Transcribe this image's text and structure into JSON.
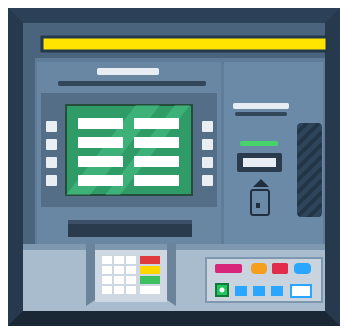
{
  "device": {
    "name": "atm-machine",
    "colors": {
      "frame_dark": "#1f2f3f",
      "bevel": "#2c4157",
      "body": "#4b647d",
      "panel": "#6b8fb0",
      "screen_bezel": "#546e87",
      "screen_bg": "#2f9c67",
      "screen_stripe": "#3bb879",
      "screen_button": "#ffffff",
      "side_button": "#e9eef3",
      "header_light": "#ffe400",
      "card_indicator": "#46d36a",
      "receipt_slot": "#2a3b4d",
      "keypad_bg": "#cfd8e2",
      "key": "#ffffff",
      "key_red": "#e03a3e",
      "key_yellow": "#ffd600",
      "key_green": "#3bbf5f",
      "control_panel": "#c9d4df",
      "btn_magenta": "#d8267a",
      "btn_orange": "#f59f1f",
      "btn_red": "#e32b4b",
      "btn_blue": "#2aa6ff",
      "btn_green": "#22c55e",
      "btn_white": "#ffffff"
    },
    "screen": {
      "rows": 4,
      "columns": 2
    },
    "side_buttons_per_side": 4,
    "keypad": {
      "rows": 4,
      "columns": 3
    },
    "control_panel": {
      "top_buttons": [
        "magenta",
        "orange",
        "red",
        "blue"
      ],
      "bottom_buttons": [
        "green-square",
        "blue",
        "blue",
        "blue",
        "white"
      ]
    },
    "icons": [
      "card-slot-icon",
      "card-insert-icon",
      "cash-dispenser-icon",
      "receipt-printer-icon"
    ]
  }
}
